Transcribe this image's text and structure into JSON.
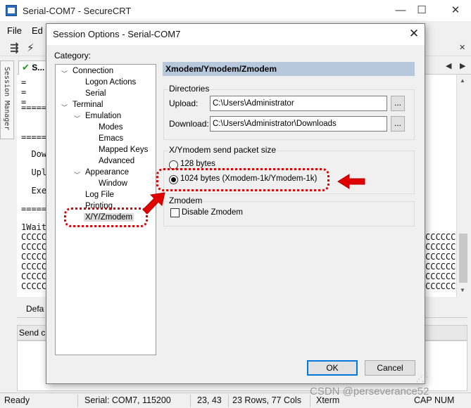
{
  "app": {
    "title": "Serial-COM7 - SecureCRT",
    "menu": [
      "File",
      "Ed"
    ],
    "window_controls": {
      "minimize": "—",
      "maximize": "☐",
      "close": "✕"
    },
    "session_manager_label": "Session Manager",
    "tab_label": "S...",
    "tab_nav": {
      "prev": "◀",
      "next": "▶"
    },
    "terminal_left": [
      "=",
      "=",
      "=",
      "=====",
      "",
      "=====",
      "  Dow",
      "  Upl",
      "  Exe",
      "=====",
      "1Wait",
      "CCCCC",
      "CCCCC",
      "CCCCC",
      "CCCCC",
      "CCCCC",
      "CCCCC"
    ],
    "terminal_right": [
      "CCCCCC",
      "CCCCCC",
      "CCCCCC",
      "CCCCCC",
      "CCCCCC",
      "CCCCCC"
    ],
    "lower_tab": "Defa",
    "send_label": "Send c"
  },
  "dialog": {
    "title": "Session Options - Serial-COM7",
    "close": "✕",
    "category_label": "Category:",
    "tree": [
      {
        "label": "Connection",
        "level": 0,
        "expanded": true
      },
      {
        "label": "Logon Actions",
        "level": 1
      },
      {
        "label": "Serial",
        "level": 1
      },
      {
        "label": "Terminal",
        "level": 0,
        "expanded": true
      },
      {
        "label": "Emulation",
        "level": 1,
        "expanded": true
      },
      {
        "label": "Modes",
        "level": 2
      },
      {
        "label": "Emacs",
        "level": 2
      },
      {
        "label": "Mapped Keys",
        "level": 2
      },
      {
        "label": "Advanced",
        "level": 2
      },
      {
        "label": "Appearance",
        "level": 1,
        "expanded": true
      },
      {
        "label": "Window",
        "level": 2
      },
      {
        "label": "Log File",
        "level": 1
      },
      {
        "label": "Printing",
        "level": 1
      },
      {
        "label": "X/Y/Zmodem",
        "level": 1,
        "selected": true
      }
    ],
    "panel_title": "Xmodem/Ymodem/Zmodem",
    "directories": {
      "label": "Directories",
      "upload_label": "Upload:",
      "upload_value": "C:\\Users\\Administrator",
      "download_label": "Download:",
      "download_value": "C:\\Users\\Administrator\\Downloads",
      "browse": "..."
    },
    "packet_size": {
      "label": "X/Ymodem send packet size",
      "option_128": "128 bytes",
      "option_1024": "1024 bytes  (Xmodem-1k/Ymodem-1k)",
      "selected": "1024"
    },
    "zmodem": {
      "label": "Zmodem",
      "disable_label": "Disable Zmodem",
      "disabled": false
    },
    "ok": "OK",
    "cancel": "Cancel"
  },
  "status": {
    "ready": "Ready",
    "port": "Serial: COM7, 115200",
    "cursor": "23,  43",
    "size": "23 Rows, 77 Cols",
    "term": "Xterm",
    "cap": "CAP",
    "num": "NUM"
  },
  "watermark": "CSDN @perseverance52",
  "colors": {
    "annotation": "#e00000",
    "selection_header": "#b8c8dc",
    "default_button": "#0078d7"
  }
}
